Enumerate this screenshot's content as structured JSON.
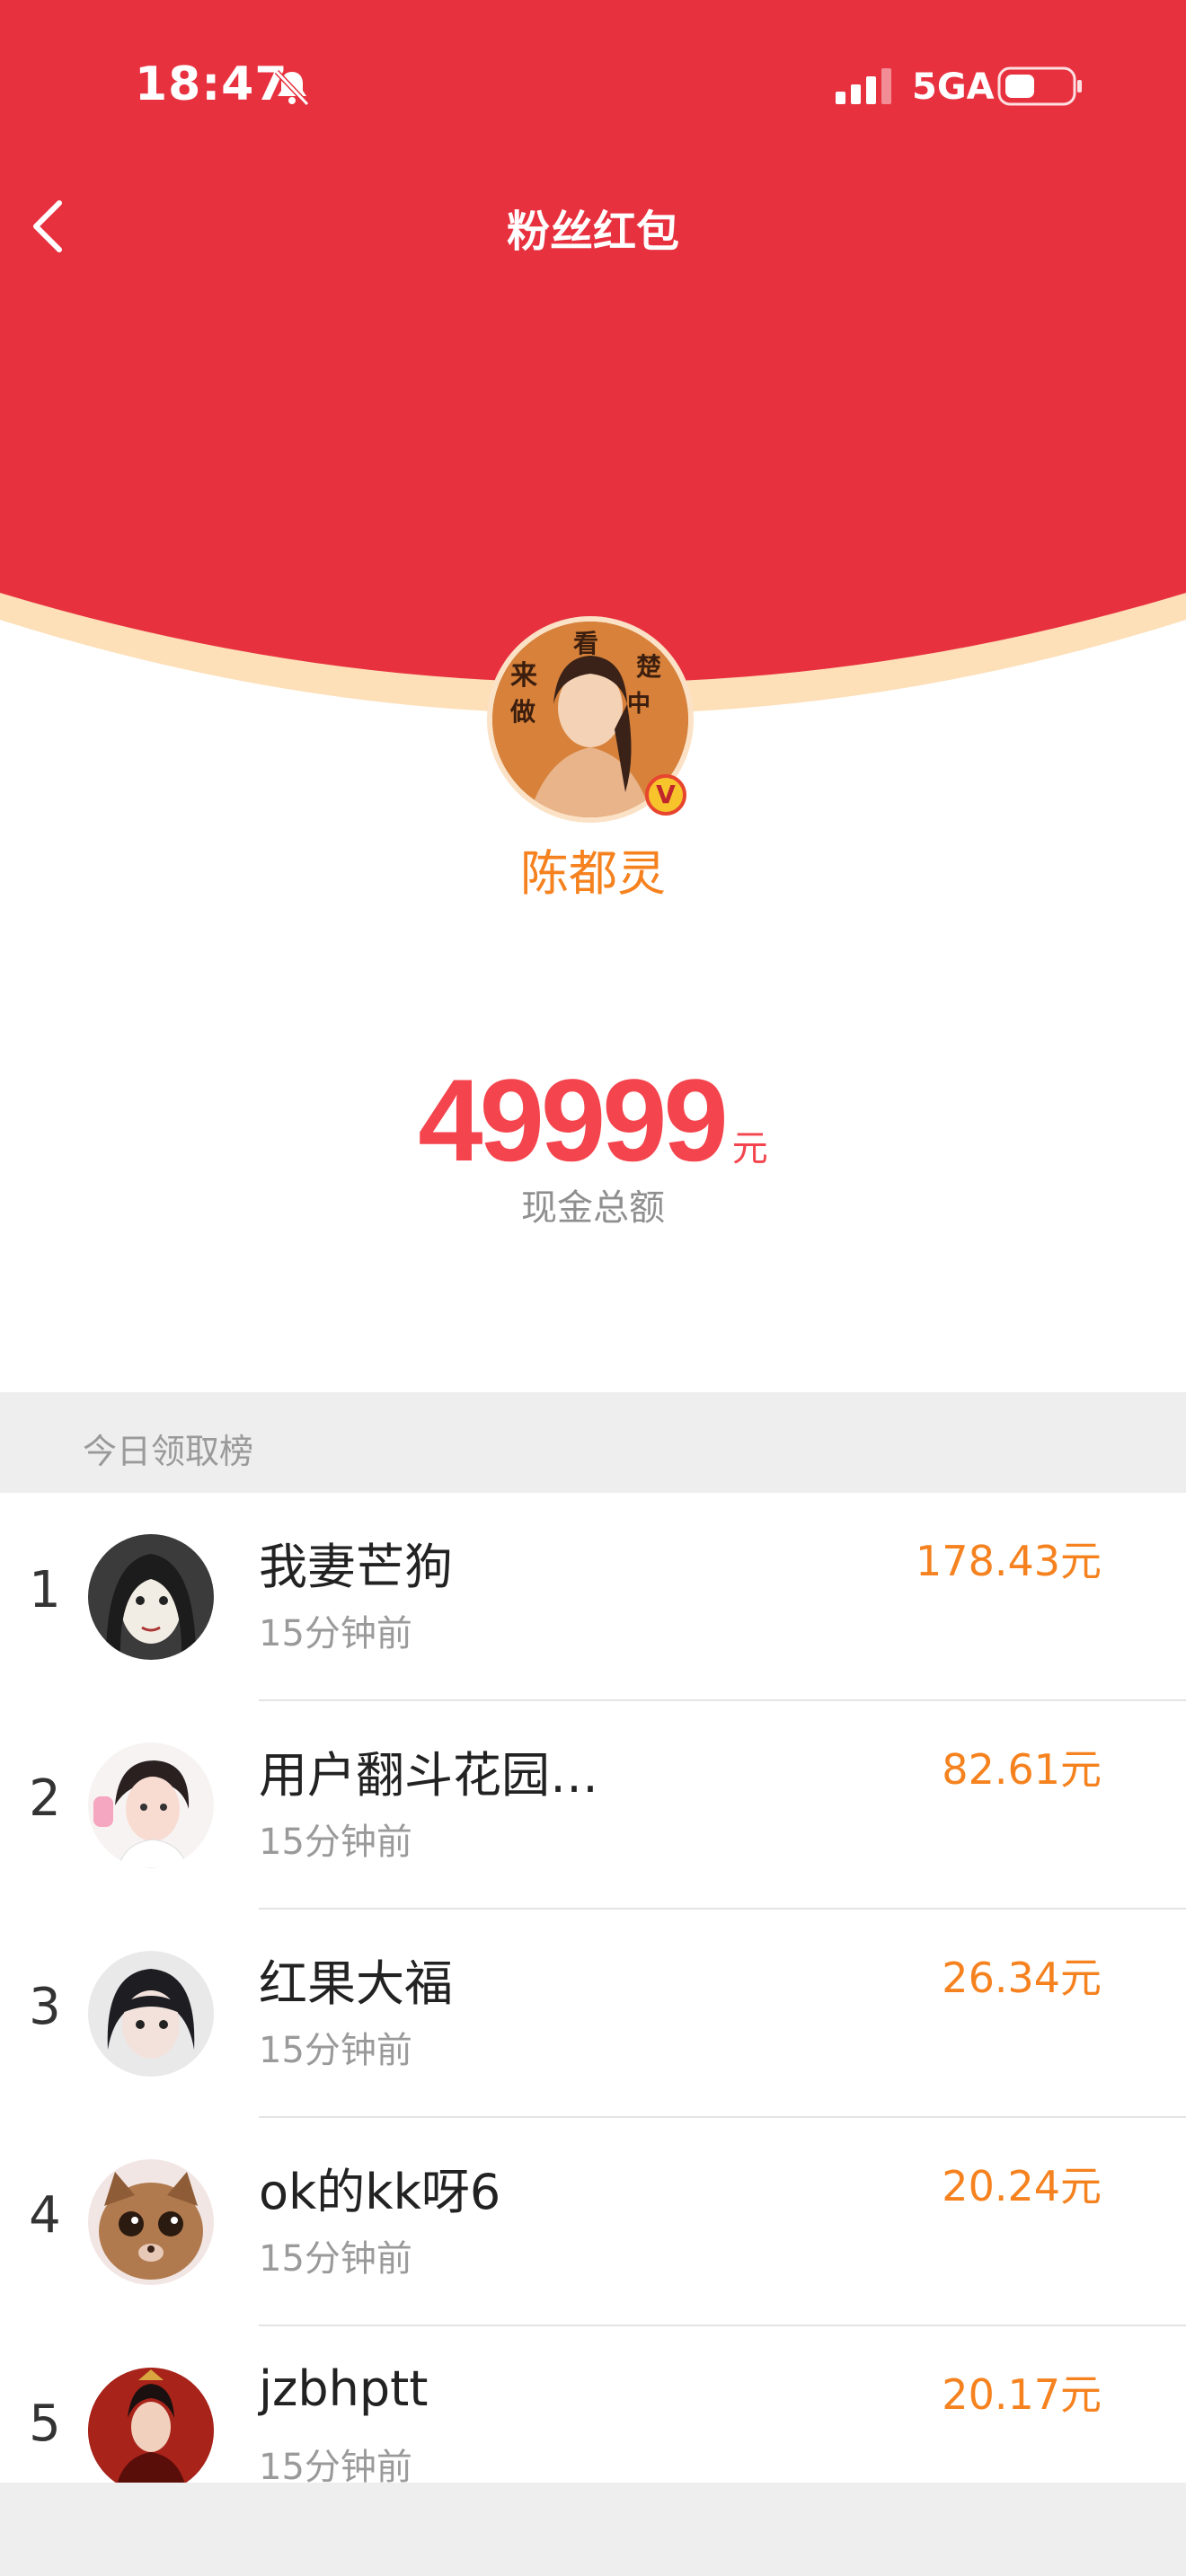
{
  "status_bar": {
    "time": "18:47",
    "network": "5GA"
  },
  "header": {
    "title": "粉丝红包"
  },
  "creator": {
    "name": "陈都灵",
    "verified_badge": "V"
  },
  "red_packet": {
    "amount": "49999",
    "unit": "元",
    "label": "现金总额"
  },
  "ranking": {
    "title": "今日领取榜",
    "entries": [
      {
        "rank": "1",
        "name": "我妻芒狗",
        "time": "15分钟前",
        "amount": "178.43元"
      },
      {
        "rank": "2",
        "name": "用户翻斗花园…",
        "time": "15分钟前",
        "amount": "82.61元"
      },
      {
        "rank": "3",
        "name": "红果大福",
        "time": "15分钟前",
        "amount": "26.34元"
      },
      {
        "rank": "4",
        "name": "ok的kk呀6",
        "time": "15分钟前",
        "amount": "20.24元"
      },
      {
        "rank": "5",
        "name": "jzbhptt",
        "time": "15分钟前",
        "amount": "20.17元"
      }
    ]
  },
  "colors": {
    "header_red": "#E8313F",
    "accent_orange": "#F5821F",
    "amount_red": "#F4444D",
    "curve_cream": "#FDDFB8"
  },
  "icons": [
    "back-chevron-icon",
    "bell-muted-icon",
    "signal-icon",
    "battery-icon",
    "verified-v-icon"
  ]
}
